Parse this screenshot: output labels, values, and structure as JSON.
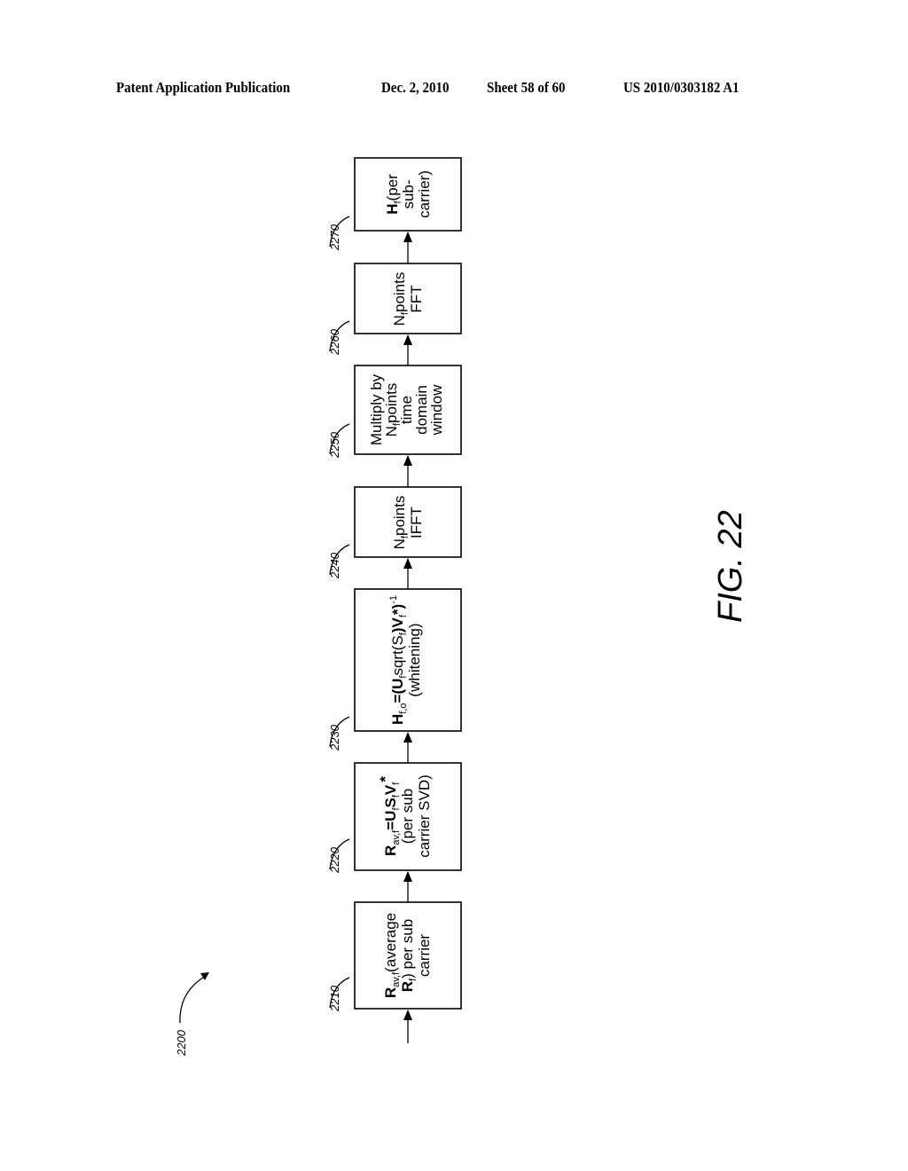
{
  "header": {
    "publication": "Patent Application Publication",
    "date": "Dec. 2, 2010",
    "sheet": "Sheet 58 of 60",
    "number": "US 2010/0303182 A1"
  },
  "figure": {
    "label": "FIG. 22",
    "ref": "2200"
  },
  "blocks": [
    {
      "ref": "2210",
      "lines": [
        "R_av,f (average",
        "R_f) per sub",
        "carrier"
      ]
    },
    {
      "ref": "2220",
      "lines": [
        "R_av,f = U_f S_f V_f*",
        "(per sub",
        "carrier SVD)"
      ]
    },
    {
      "ref": "2230",
      "lines": [
        "H_f,o = (U_f sqrt(S_f) V_f*)^-1",
        "(whitening)"
      ]
    },
    {
      "ref": "2240",
      "lines": [
        "N_f points",
        "IFFT"
      ]
    },
    {
      "ref": "2250",
      "lines": [
        "Multiply by",
        "N_f points",
        "time",
        "domain",
        "window"
      ]
    },
    {
      "ref": "2260",
      "lines": [
        "N_f points",
        "FFT"
      ]
    },
    {
      "ref": "2270",
      "lines": [
        "H_f (per",
        "sub-",
        "carrier)"
      ]
    }
  ],
  "text": {
    "b2210_l1_main": "R",
    "b2210_l1_sub": "av,f",
    "b2210_l1_rest": "(average",
    "b2210_l2_main": "R",
    "b2210_l2_sub": "f",
    "b2210_l2_rest": ") per sub",
    "b2210_l3": "carrier",
    "b2220_l1_a": "R",
    "b2220_l1_asub": "av,f",
    "b2220_l1_b": "=U",
    "b2220_l1_bsub": "f",
    "b2220_l1_c": "S",
    "b2220_l1_csub": "f",
    "b2220_l1_d": "V",
    "b2220_l1_dsub": "f",
    "b2220_l1_e": "*",
    "b2220_l2": "(per sub",
    "b2220_l3": "carrier SVD)",
    "b2230_l1_a": "H",
    "b2230_l1_asub": "f,o",
    "b2230_l1_b": "=(U",
    "b2230_l1_bsub": "f",
    "b2230_l1_c": "sqrt(S",
    "b2230_l1_csub": "f",
    "b2230_l1_d": ")V",
    "b2230_l1_dsub": "f",
    "b2230_l1_e": "*)",
    "b2230_l1_sup": "-1",
    "b2230_l2": "(whitening)",
    "b2240_l1_a": "N",
    "b2240_l1_sub": "f",
    "b2240_l1_b": "points",
    "b2240_l2": "IFFT",
    "b2250_l1": "Multiply by",
    "b2250_l2_a": "N",
    "b2250_l2_sub": "f",
    "b2250_l2_b": "points",
    "b2250_l3": "time",
    "b2250_l4": "domain",
    "b2250_l5": "window",
    "b2260_l1_a": "N",
    "b2260_l1_sub": "f",
    "b2260_l1_b": "points",
    "b2260_l2": "FFT",
    "b2270_l1_a": "H",
    "b2270_l1_sub": "f",
    "b2270_l1_b": "(per",
    "b2270_l2": "sub-",
    "b2270_l3": "carrier)"
  }
}
